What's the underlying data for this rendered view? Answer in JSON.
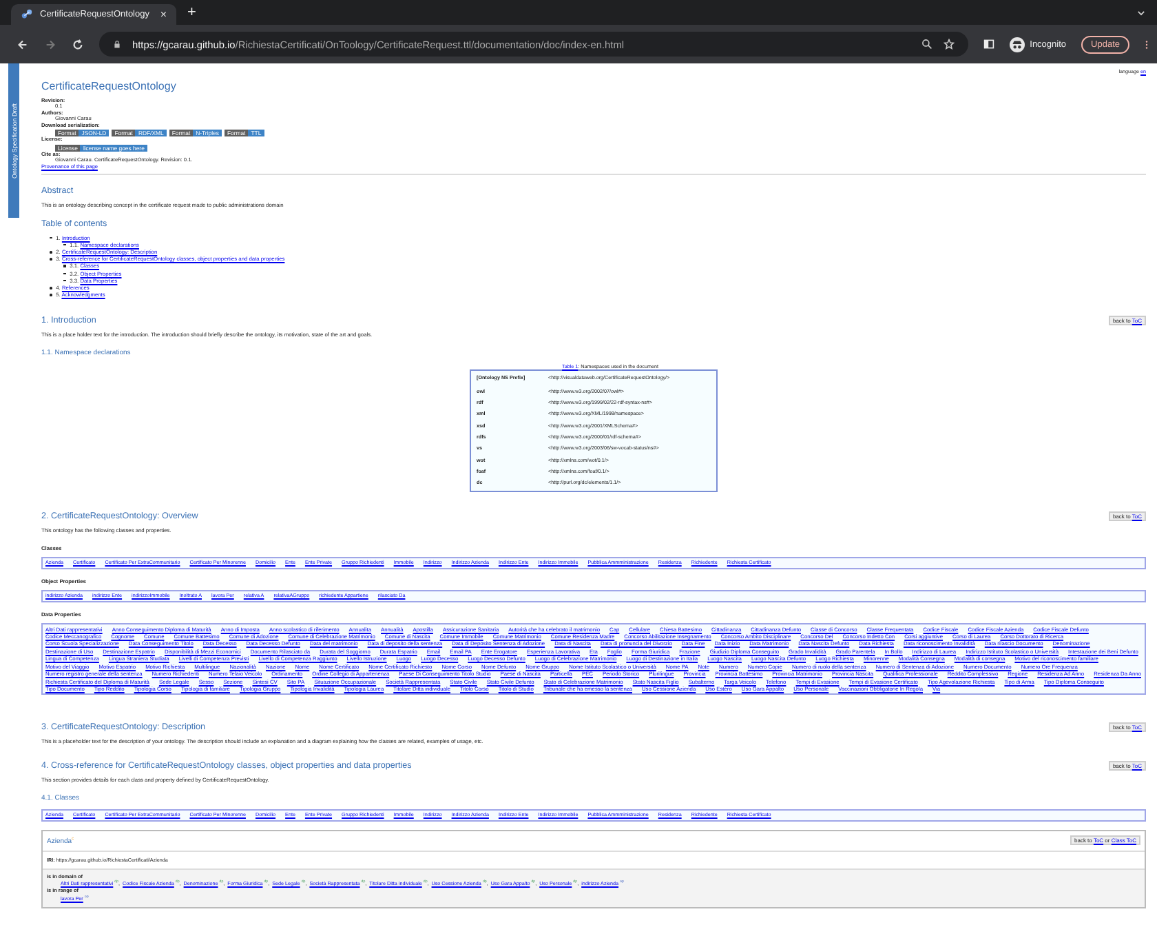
{
  "browser": {
    "tab_title": "CertificateRequestOntology",
    "tab_close": "×",
    "new_tab": "+",
    "url_host": "https://gcarau.github.io",
    "url_path": "/RichiestaCertificati/OnToology/CertificateRequest.ttl/documentation/doc/index-en.html",
    "profile": "Incognito",
    "update": "Update"
  },
  "side_label": "Ontology Specification Draft",
  "language": {
    "label": "language",
    "value": "en"
  },
  "header": {
    "title": "CertificateRequestOntology",
    "fields": [
      {
        "label": "Revision:",
        "value": "0.1"
      },
      {
        "label": "Authors:",
        "value": "Giovanni Carau"
      }
    ],
    "download_label": "Download serialization:",
    "formats": [
      {
        "tag": "Format",
        "name": "JSON-LD"
      },
      {
        "tag": "Format",
        "name": "RDF/XML"
      },
      {
        "tag": "Format",
        "name": "N-Triples"
      },
      {
        "tag": "Format",
        "name": "TTL"
      }
    ],
    "license_label": "License:",
    "license": {
      "tag": "License",
      "name": "license name goes here"
    },
    "cite_label": "Cite as:",
    "cite": "Giovanni Carau. CertificateRequestOntology. Revision: 0.1.",
    "provenance": "Provenance of this page"
  },
  "abstract": {
    "title": "Abstract",
    "text": "This is an ontology describing concept in the certificate request made to public administrations domain"
  },
  "toc": {
    "title": "Table of contents",
    "items": [
      {
        "num": "1.",
        "label": "Introduction",
        "children": [
          {
            "num": "1.1.",
            "label": "Namespace declarations"
          }
        ]
      },
      {
        "num": "2.",
        "label": "CertificateRequestOntology: Description"
      },
      {
        "num": "3.",
        "label": "Cross-reference for CertificateRequestOntology classes, object properties and data properties",
        "children": [
          {
            "num": "3.1.",
            "label": "Classes"
          },
          {
            "num": "3.2.",
            "label": "Object Properties"
          },
          {
            "num": "3.3.",
            "label": "Data Properties"
          }
        ]
      },
      {
        "num": "4.",
        "label": "References"
      },
      {
        "num": "5.",
        "label": "Acknowledgments"
      }
    ]
  },
  "intro": {
    "title": "1. Introduction",
    "back": "back to ",
    "toc_link": "ToC",
    "text": "This is a place holder text for the introduction. The introduction should briefly describe the ontology, its motivation, state of the art and goals.",
    "sub": "1.1. Namespace declarations"
  },
  "ns_table": {
    "caption_link": "Table 1",
    "caption": ": Namespaces used in the document",
    "head": {
      "prefix": "[Ontology NS Prefix]",
      "uri": "<http://visualdataweb.org/CertificateRequestOntology/>"
    },
    "rows": [
      {
        "prefix": "owl",
        "uri": "<http://www.w3.org/2002/07/owl#>"
      },
      {
        "prefix": "rdf",
        "uri": "<http://www.w3.org/1999/02/22-rdf-syntax-ns#>"
      },
      {
        "prefix": "xml",
        "uri": "<http://www.w3.org/XML/1998/namespace>"
      },
      {
        "prefix": "xsd",
        "uri": "<http://www.w3.org/2001/XMLSchema#>"
      },
      {
        "prefix": "rdfs",
        "uri": "<http://www.w3.org/2000/01/rdf-schema#>"
      },
      {
        "prefix": "vs",
        "uri": "<http://www.w3.org/2003/06/sw-vocab-status/ns#>"
      },
      {
        "prefix": "wot",
        "uri": "<http://xmlns.com/wot/0.1/>"
      },
      {
        "prefix": "foaf",
        "uri": "<http://xmlns.com/foaf/0.1/>"
      },
      {
        "prefix": "dc",
        "uri": "<http://purl.org/dc/elements/1.1/>"
      }
    ]
  },
  "overview": {
    "title": "2. CertificateRequestOntology: Overview",
    "back": "back to ",
    "toc_link": "ToC",
    "text": "This ontology has the following classes and properties.",
    "classes_title": "Classes",
    "classes": [
      "Azienda",
      "Certificato",
      "Certificato Per ExtraCommunitario",
      "Certificato Per Minorenne",
      "Domicilio",
      "Ente",
      "Ente Private",
      "Gruppo Richiedenti",
      "Immobile",
      "Indirizzo",
      "Indirizzo Azienda",
      "Indirizzo Ente",
      "Indirizzo Immobile",
      "Pubblica Ammministrazione",
      "Residenza",
      "Richiedente",
      "Richiesta Certificato"
    ],
    "object_title": "Object Properties",
    "object_properties": [
      "indirizzo Azienda",
      "indirizzo Ente",
      "indirizzoImmobile",
      "Inoltrato A",
      "lavora Per",
      "relativa A",
      "relativaAGruppo",
      "richiedente Appartiene",
      "rilasciato Da"
    ],
    "data_title": "Data Properties",
    "data_properties": [
      "Altri Dati rappresentativi",
      "Anno Conseguimento Diploma di Maturità",
      "Anno di Imposta",
      "Anno scolastico di riferimento",
      "Annualita",
      "Annualità",
      "Apostilla",
      "Assicurazione Sanitaria",
      "Autorità che ha celebrato il matrimonio",
      "Cap",
      "Cellulare",
      "Chiesa Battesimo",
      "Cittadinanza",
      "Cittadinanza Defunto",
      "Classe di Concorso",
      "Classe Frequentata",
      "Codice Fiscale",
      "Codice Fiscale Azienda",
      "Codice Fiscale Defunto",
      "Codice Meccanografico",
      "Cognome",
      "Comune",
      "Comune Battesimo",
      "Comune di Adozione",
      "Comune di Celebrazione Matrimonio",
      "Comune di Nascita",
      "Comune Immobile",
      "Comune Matrimonio",
      "Comune Residenza Madre",
      "Concorso Abilitazione Insegnamento",
      "Concorso Ambito Disciplinare",
      "Concorso Del",
      "Concorso Indetto Con",
      "Corsi aggiuntive",
      "Corso di Laurea",
      "Corso Dottorato di Ricerca",
      "Corso Scuola Specializzazione",
      "Data Conseguimento Titolo",
      "Data Decesso",
      "Data Decesso Defunto",
      "Data del matrimonio",
      "Data di deposito della sentenza",
      "Data di Deposito Sentenza di Adozione",
      "Data di Nascita",
      "Data di pronuncia del Divorzio",
      "Data Fine",
      "Data Inizio",
      "Data Matrimonio",
      "Data Nascita Defunto",
      "Data Richiesta",
      "Data riconoscimento Invalidità",
      "Data rilascio Documento",
      "Denominazione",
      "Destinazione di Uso",
      "Destinazione Espatrio",
      "Disponibilità di Mezzi Economici",
      "Documento Rilasciato da",
      "Durata del Soggiorno",
      "Durata Espatrio",
      "Email",
      "Email PA",
      "Ente Erogatore",
      "Esperienza Lavorativa",
      "Eta",
      "Foglio",
      "Forma Giuridica",
      "Frazione",
      "Giudizio Diploma Conseguito",
      "Grado Invalidità",
      "Grado Parentela",
      "In Bollo",
      "Indirizzo di Laurea",
      "Indirizzo Istituto Scolastico o Università",
      "Intestazione dei Beni Defunto",
      "Lingua di Competenza",
      "Lingua Straniera Studiata",
      "Livelli di Competenza Previsti",
      "Livello di Competenza Raggiunto",
      "Livello Istruzione",
      "Luogo",
      "Luogo Decesso",
      "Luogo Decesso Defunto",
      "Luogo di Celebrazione Matrimonio",
      "Luogo di Destinazione in Italia",
      "Luogo Nascita",
      "Luogo Nascita Defunto",
      "Luogo Richiesta",
      "Minorenne",
      "Modalità Consegna",
      "Modalità di consegna",
      "Motivo del riconoscimento familiare",
      "Motivo del Viaggio",
      "Motivo Espatrio",
      "Motivo Richiesta",
      "Multilingue",
      "Nazionalità",
      "Nazione",
      "Nome",
      "Nome Certificato",
      "Nome Certificato Richiesto",
      "Nome Corso",
      "Nome Defunto",
      "Nome Gruppo",
      "Nome Istituto Scolastico o Università",
      "Nome PA",
      "Note",
      "Numero",
      "Numero Copie",
      "Numero di ruolo della sentenza",
      "Numero di Sentenza di Adozione",
      "Numero Documento",
      "Numero Ore Frequenza",
      "Numero registro generale della sentenza",
      "Numero Richiedenti",
      "Numero Telaio Veicolo",
      "Ordinamento",
      "Ordine Collegio di Appartenenza",
      "Paese Di Conseguimento Titolo Studio",
      "Paese di Nascita",
      "Particella",
      "PEC",
      "Periodo Storico",
      "Plurilingue",
      "Provincia",
      "Provincia Battesimo",
      "Provincia Matrimonio",
      "Provincia Nascita",
      "Qualifica Professionale",
      "Reddito Complessivo",
      "Regione",
      "Residenza Ad Anno",
      "Residenza Da Anno",
      "Richiesta Certificato del Diploma di Maturità",
      "Sede Legale",
      "Sesso",
      "Sezione",
      "Sintesi CV",
      "Sito PA",
      "Situazione Occupazionale",
      "Società Rappresentata",
      "Stato Civile",
      "Stato Civile Defunto",
      "Stato di Celebrazione Matrimonio",
      "Stato Nascita Figlio",
      "Subalterno",
      "Targa Veicolo",
      "Telefono",
      "Tempi di Evasione",
      "Tempi di Evasione Certificato",
      "Tipo Agevolazione Richiesta",
      "Tipo di Arma",
      "Tipo Diploma Conseguito",
      "Tipo Documento",
      "Tipo Reddito",
      "Tipologia Corso",
      "Tipologia di familiare",
      "Tipologia Gruppo",
      "Tipologia Invalidità",
      "Tipologia Laurea",
      "Titolare Ditta individuale",
      "Titolo Corso",
      "Titolo di Studio",
      "Tribunale che ha emesso la sentenza",
      "Uso Cessione Azienda",
      "Uso Estero",
      "Uso Gara Appalto",
      "Uso Personale",
      "Vaccinazioni Obbligatorie In Regola",
      "Via"
    ]
  },
  "description": {
    "title": "3. CertificateRequestOntology: Description",
    "back": "back to ",
    "toc_link": "ToC",
    "text": "This is a placeholder text for the description of your ontology. The description should include an explanation and a diagram explaining how the classes are related, examples of usage, etc."
  },
  "crossref": {
    "title": "4. Cross-reference for CertificateRequestOntology classes, object properties and data properties",
    "back": "back to ",
    "toc_link": "ToC",
    "text": "This section provides details for each class and property defined by CertificateRequestOntology.",
    "sub": "4.1. Classes",
    "classes": [
      "Azienda",
      "Certificato",
      "Certificato Per ExtraCommunitario",
      "Certificato Per Minorenne",
      "Domicilio",
      "Ente",
      "Ente Private",
      "Gruppo Richiedenti",
      "Immobile",
      "Indirizzo",
      "Indirizzo Azienda",
      "Indirizzo Ente",
      "Indirizzo Immobile",
      "Pubblica Ammministrazione",
      "Residenza",
      "Richiedente",
      "Richiesta Certificato"
    ],
    "entity": {
      "name": "Azienda",
      "mark": "c",
      "back": "back to ",
      "toc_link": "ToC",
      "or": " or ",
      "class_toc": "Class ToC",
      "separator": ",",
      "iri_label": "IRI:",
      "iri": "https://gcarau.github.io/RichiestaCertificati/Azienda",
      "domain_label": "is in domain of",
      "domain": [
        {
          "label": "Altri Dati rappresentativi",
          "mark": "dp"
        },
        {
          "label": "Codice Fiscale Azienda",
          "mark": "dp"
        },
        {
          "label": "Denominazione",
          "mark": "dp"
        },
        {
          "label": "Forma Giuridica",
          "mark": "dp"
        },
        {
          "label": "Sede Legale",
          "mark": "dp"
        },
        {
          "label": "Società Rappresentata",
          "mark": "dp"
        },
        {
          "label": "Titolare Ditta individuale",
          "mark": "dp"
        },
        {
          "label": "Uso Cessione Azienda",
          "mark": "dp"
        },
        {
          "label": "Uso Gara Appalto",
          "mark": "dp"
        },
        {
          "label": "Uso Personale",
          "mark": "dp"
        },
        {
          "label": "indirizzo Azienda",
          "mark": "op"
        }
      ],
      "range_label": "is in range of",
      "range": [
        {
          "label": "lavora Per",
          "mark": "op"
        }
      ]
    }
  }
}
